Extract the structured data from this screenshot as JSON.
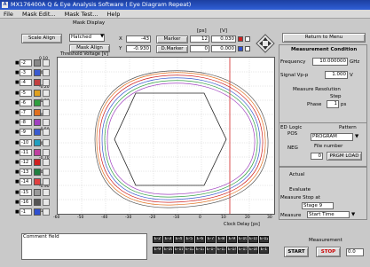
{
  "window": {
    "title": "MX176400A Q & Eye Analysis Software ( Eye Diagram   Repeat)",
    "logo": "A"
  },
  "menu": [
    "File",
    "Mask Edit...",
    "Mask Test...",
    "Help"
  ],
  "toolbar": {
    "scale_align": "Scale Align",
    "mask_display_label": "Mask Display",
    "mask_display_value": "Hatched",
    "mask_align": "Mask Align",
    "x_label": "X",
    "x_value": "-43",
    "y_label": "Y",
    "y_value": "-0.930",
    "ps_unit": "[ps]",
    "v_unit": "[V]",
    "marker_label": "Marker",
    "marker_ps": "12",
    "marker_v": "0.030",
    "dmarker_label": "D.Marker",
    "dmarker_ps": "0",
    "dmarker_v": "0.000",
    "return_menu": "Return to Menu"
  },
  "plot": {
    "y_title": "Threshold Voltage [V]",
    "x_title": "Clock Delay [ps]",
    "y_ticks": [
      "0.10",
      "-0.10",
      "-0.20",
      "-0.30",
      "-0.40",
      "-0.50",
      "-0.60",
      "-0.70",
      "-0.80",
      "-0.90",
      "-1.00"
    ],
    "x_ticks": [
      "-60",
      "-50",
      "-40",
      "-30",
      "-20",
      "-10",
      "0",
      "10",
      "20",
      "30"
    ]
  },
  "channels": [
    {
      "label": "-2",
      "color": "#888888"
    },
    {
      "label": "-3",
      "color": "#3a5bd0"
    },
    {
      "label": "-4",
      "color": "#c24040"
    },
    {
      "label": "-5",
      "color": "#e0a020"
    },
    {
      "label": "-6",
      "color": "#30a040"
    },
    {
      "label": "-7",
      "color": "#e07020"
    },
    {
      "label": "-8",
      "color": "#a040c0"
    },
    {
      "label": "-9",
      "color": "#3a5bd0"
    },
    {
      "label": "-10",
      "color": "#20a0c0"
    },
    {
      "label": "-11",
      "color": "#c040a0"
    },
    {
      "label": "-12",
      "color": "#d02020"
    },
    {
      "label": "-13",
      "color": "#208040"
    },
    {
      "label": "-14",
      "color": "#e04040"
    },
    {
      "label": "-15",
      "color": "#9a9a9a"
    },
    {
      "label": "-16",
      "color": "#555555"
    },
    {
      "label": "-1",
      "color": "#3050d0"
    }
  ],
  "right_panel": {
    "meas_condition": "Measurement Condition",
    "frequency_label": "Frequency",
    "frequency_value": "10.000000",
    "frequency_unit": "GHz",
    "signal_label": "Signal Vp-p",
    "signal_value": "1.000",
    "signal_unit": "V",
    "resolution_label": "Measure Resolution",
    "step_label": "Step",
    "phase_label": "Phase",
    "phase_value": "1",
    "phase_unit": "ps",
    "ed_label": "ED",
    "logic_label": "Logic",
    "pattern_label": "Pattern",
    "pos_label": "POS",
    "neg_label": "NEG",
    "program_value": "PROGRAM",
    "file_number_label": "File number",
    "file_number_value": "0",
    "prgm_load": "PRGM LOAD",
    "actual_label": "Actual",
    "evaluate_label": "Evaluate",
    "stop_label": "Measure Stop at",
    "stage_value": "Stage 9",
    "measure_label": "Measure",
    "start_time_value": "Start Time",
    "measurement_title": "Measurement",
    "start_button": "START",
    "stop_button": "STOP",
    "extra_value": "0.0"
  },
  "bottom": {
    "comment_label": "Comment field",
    "grid_row1": [
      "E-2",
      "E-3",
      "E-4",
      "E-5",
      "E-6",
      "E-7",
      "E-8",
      "E-9",
      "E-10",
      "E-11",
      "E-12"
    ],
    "grid_row2": [
      "E-9",
      "E-10",
      "E-11",
      "E-12",
      "E-13",
      "E-1-2",
      "E-13",
      "E-14",
      "E-15",
      "E-16",
      "E-1"
    ]
  }
}
